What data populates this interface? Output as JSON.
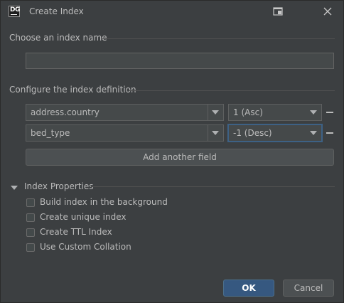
{
  "window": {
    "title": "Create Index",
    "app_icon_text": "DG"
  },
  "sections": {
    "name_label": "Choose an index name",
    "name_value": "",
    "definition_label": "Configure the index definition",
    "properties_label": "Index Properties"
  },
  "fields": [
    {
      "field": "address.country",
      "order": "1 (Asc)"
    },
    {
      "field": "bed_type",
      "order": "-1 (Desc)"
    }
  ],
  "add_field_label": "Add another field",
  "properties": [
    {
      "label": "Build index in the background",
      "checked": false
    },
    {
      "label": "Create unique index",
      "checked": false
    },
    {
      "label": "Create TTL Index",
      "checked": false
    },
    {
      "label": "Use Custom Collation",
      "checked": false
    }
  ],
  "buttons": {
    "ok": "OK",
    "cancel": "Cancel"
  },
  "colors": {
    "background": "#3c3f41",
    "primary_button": "#365880",
    "focus_border": "#3d6185"
  }
}
